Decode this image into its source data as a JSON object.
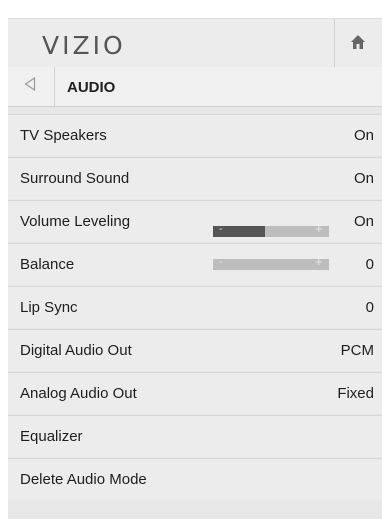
{
  "header": {
    "logo_text": "VIZIO",
    "home_icon": "home-icon"
  },
  "breadcrumb": {
    "back_icon": "back-triangle-icon",
    "title": "AUDIO"
  },
  "menu": {
    "items": [
      {
        "label": "TV Speakers",
        "value": "On"
      },
      {
        "label": "Surround Sound",
        "value": "On"
      },
      {
        "label": "Volume Leveling",
        "value": "On"
      },
      {
        "label": "Balance",
        "value": "0"
      },
      {
        "label": "Lip Sync",
        "value": "0"
      },
      {
        "label": "Digital Audio Out",
        "value": "PCM"
      },
      {
        "label": "Analog Audio Out",
        "value": "Fixed"
      },
      {
        "label": "Equalizer",
        "value": ""
      },
      {
        "label": "Delete Audio Mode",
        "value": ""
      }
    ]
  },
  "sliders": {
    "volume": {
      "minus": "-",
      "plus": "+",
      "level": 0.45
    },
    "balance": {
      "minus": "-",
      "plus": "+",
      "level": 0.0
    }
  },
  "colors": {
    "panel_bg": "#e7e7e7",
    "row_bg": "#ececec",
    "slider_fill": "#555555",
    "slider_track": "#bdbdbd"
  }
}
